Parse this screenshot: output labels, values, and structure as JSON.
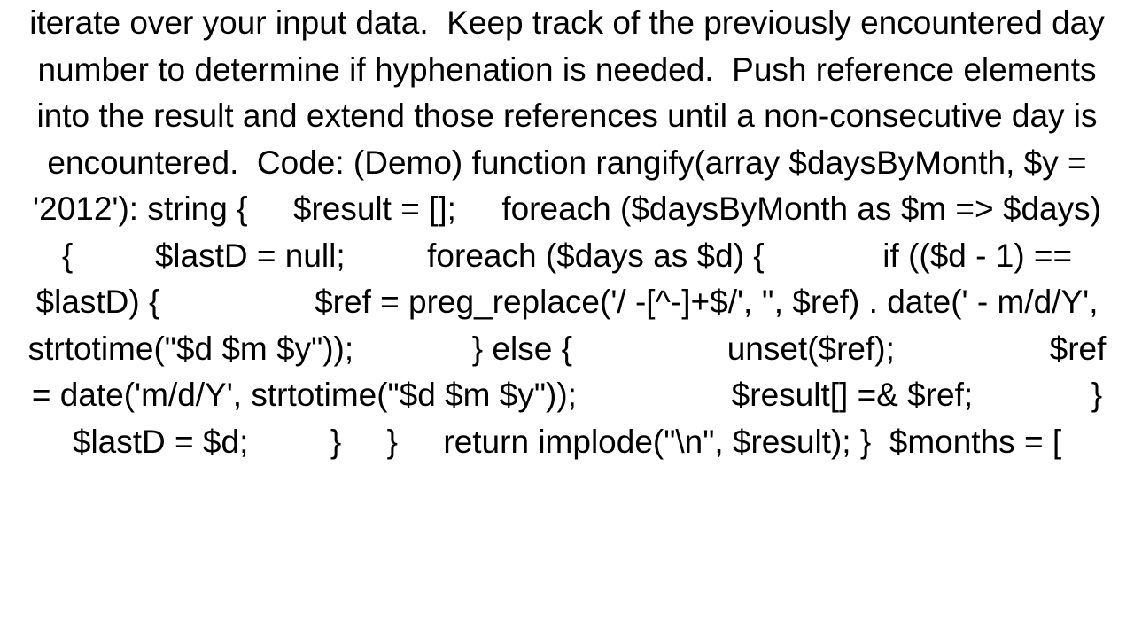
{
  "text": {
    "body": "iterate over your input data.  Keep track of the previously encountered day number to determine if hyphenation is needed.  Push reference elements into the result and extend those references until a non-consecutive day is encountered.  Code: (Demo) function rangify(array $daysByMonth, $y = '2012'): string {     $result = [];     foreach ($daysByMonth as $m => $days) {         $lastD = null;         foreach ($days as $d) {             if (($d - 1) == $lastD) {                 $ref = preg_replace('/ -[^-]+$/', '', $ref) . date(' - m/d/Y', strtotime(\"$d $m $y\"));             } else {                 unset($ref);                 $ref = date('m/d/Y', strtotime(\"$d $m $y\"));                 $result[] =& $ref;             }             $lastD = $d;         }     }     return implode(\"\\n\", $result); }  $months = ["
  }
}
